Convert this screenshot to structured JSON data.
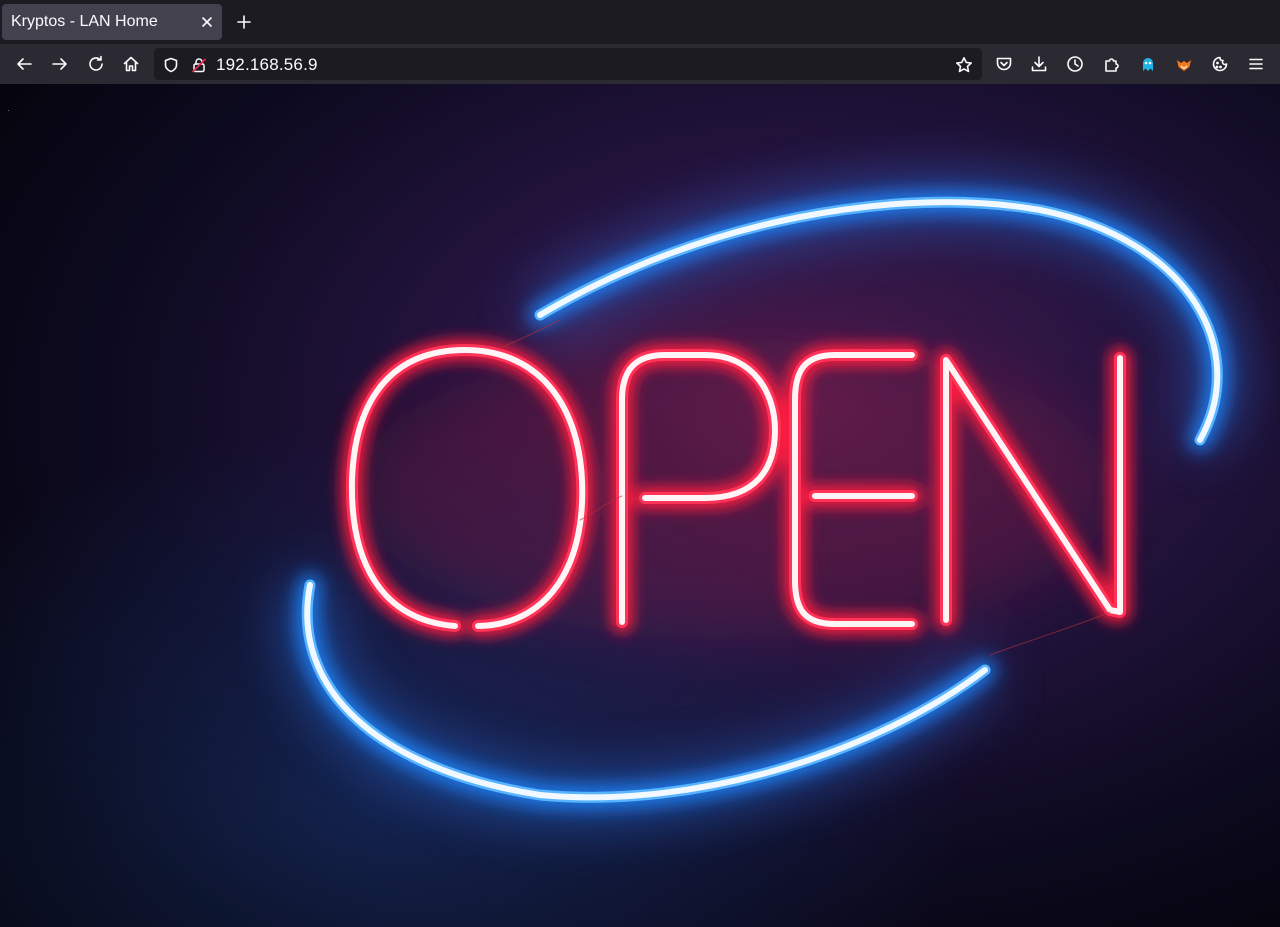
{
  "tab": {
    "title": "Kryptos - LAN Home"
  },
  "address_bar": {
    "url": "192.168.56.9"
  },
  "toolbar": {
    "extension_badge_count": "0"
  },
  "page": {
    "image": {
      "type": "neon-sign",
      "sign_text": "OPEN",
      "colors": {
        "letters": "#ff2a4a",
        "ring": "#1e8bff",
        "background": "#0c0b1c"
      }
    }
  }
}
